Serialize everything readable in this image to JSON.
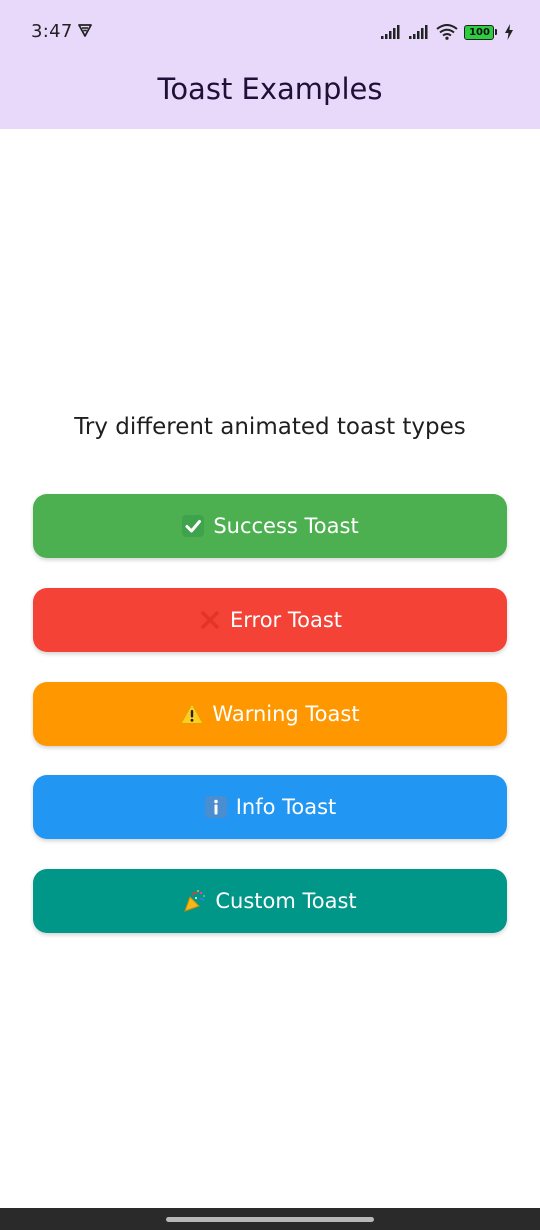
{
  "status_bar": {
    "time": "3:47",
    "battery_level": "100",
    "icons": [
      "vpn-icon",
      "signal-icon",
      "signal-icon",
      "wifi-icon",
      "battery-icon",
      "charging-bolt-icon"
    ]
  },
  "app_bar": {
    "title": "Toast Examples",
    "background": "#e8d9fb"
  },
  "main": {
    "subtitle": "Try different animated toast types",
    "buttons": [
      {
        "label": "Success Toast",
        "icon": "check-mark-icon",
        "color": "#4caf50"
      },
      {
        "label": "Error Toast",
        "icon": "cross-mark-icon",
        "color": "#f44336"
      },
      {
        "label": "Warning Toast",
        "icon": "warning-icon",
        "color": "#ff9800"
      },
      {
        "label": "Info Toast",
        "icon": "info-icon",
        "color": "#2196f3"
      },
      {
        "label": "Custom Toast",
        "icon": "party-popper-icon",
        "color": "#009688"
      }
    ]
  }
}
